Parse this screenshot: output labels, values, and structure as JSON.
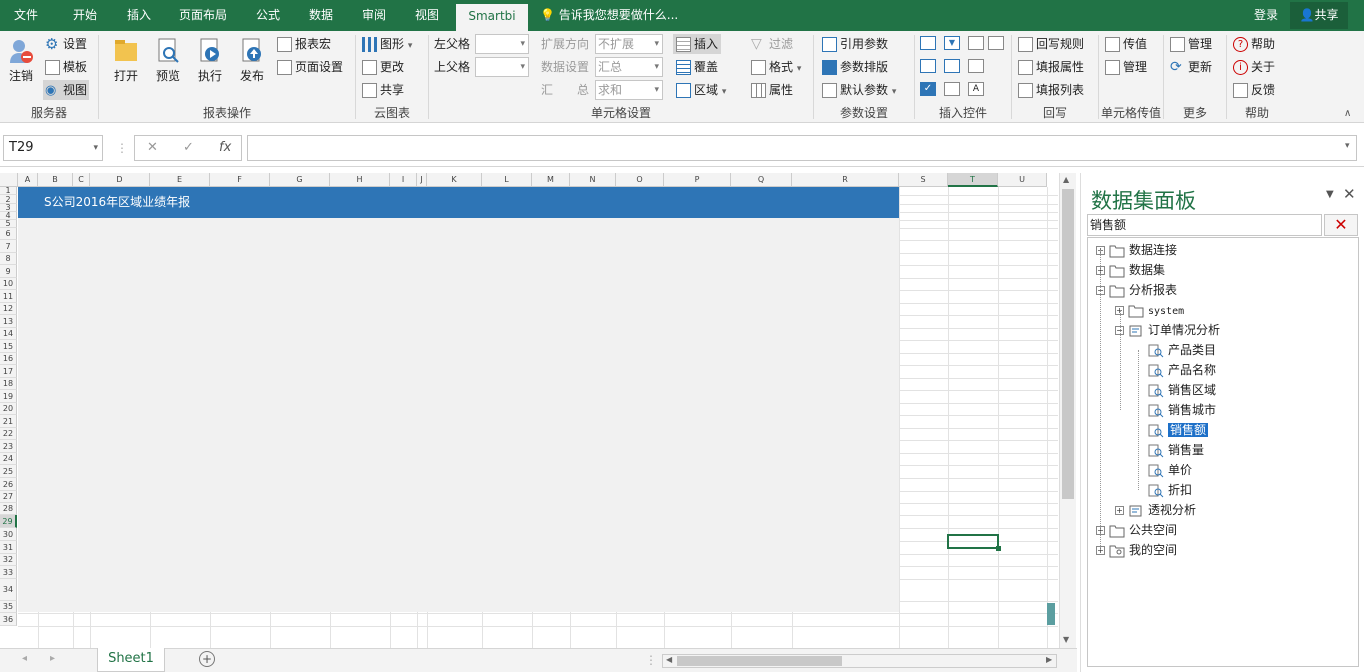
{
  "tabs": [
    "文件",
    "开始",
    "插入",
    "页面布局",
    "公式",
    "数据",
    "审阅",
    "视图",
    "Smartbi"
  ],
  "tell_me": "告诉我您想要做什么...",
  "login": "登录",
  "share": "共享",
  "ribbon": {
    "server": {
      "logout": "注销",
      "settings": "设置",
      "template": "模板",
      "view": "视图",
      "group": "服务器"
    },
    "report_ops": {
      "open": "打开",
      "preview": "预览",
      "execute": "执行",
      "publish": "发布",
      "report_macro": "报表宏",
      "page_setup": "页面设置",
      "group": "报表操作"
    },
    "cloud": {
      "chart": "图形",
      "change": "更改",
      "share": "共享",
      "group": "云图表"
    },
    "cell_settings": {
      "left_parent": "左父格",
      "upper_parent": "上父格",
      "expand_direction": "扩展方向",
      "expand_value": "不扩展",
      "data_setting": "数据设置",
      "data_value": "汇总",
      "summary": "汇　　总",
      "summary_value": "求和",
      "insert": "插入",
      "overwrite": "覆盖",
      "region": "区域",
      "filter": "过滤",
      "format": "格式",
      "property": "属性",
      "group": "单元格设置"
    },
    "params": {
      "cite": "引用参数",
      "layout": "参数排版",
      "default": "默认参数",
      "group": "参数设置"
    },
    "controls": {
      "group": "插入控件"
    },
    "writeback": {
      "rule": "回写规则",
      "attr": "填报属性",
      "list": "填报列表",
      "group": "回写"
    },
    "cell_value": {
      "transfer": "传值",
      "manage": "管理",
      "group": "单元格传值"
    },
    "more": {
      "manage": "管理",
      "update": "更新",
      "group": "更多"
    },
    "help": {
      "help": "帮助",
      "about": "关于",
      "feedback": "反馈",
      "group": "帮助"
    }
  },
  "formula_bar": {
    "name_box": "T29",
    "value": ""
  },
  "columns": [
    "A",
    "B",
    "C",
    "D",
    "E",
    "F",
    "G",
    "H",
    "I",
    "J",
    "K",
    "L",
    "M",
    "N",
    "O",
    "P",
    "Q",
    "R",
    "S",
    "T",
    "U"
  ],
  "rows": [
    "1",
    "2",
    "3",
    "4",
    "5",
    "6",
    "7",
    "8",
    "9",
    "10",
    "11",
    "12",
    "13",
    "14",
    "15",
    "16",
    "17",
    "18",
    "19",
    "20",
    "21",
    "22",
    "23",
    "24",
    "25",
    "26",
    "27",
    "28",
    "29",
    "30",
    "31",
    "32",
    "33",
    "34",
    "35",
    "36"
  ],
  "banner_title": "S公司2016年区域业绩年报",
  "sheet_tab": "Sheet1",
  "panel": {
    "title": "数据集面板",
    "search_value": "销售额",
    "tree": [
      {
        "label": "数据连接",
        "level": 0,
        "toggle": "+",
        "icon": "folder"
      },
      {
        "label": "数据集",
        "level": 0,
        "toggle": "+",
        "icon": "folder"
      },
      {
        "label": "分析报表",
        "level": 0,
        "toggle": "-",
        "icon": "folder"
      },
      {
        "label": "system",
        "level": 1,
        "toggle": "+",
        "icon": "folder"
      },
      {
        "label": "订单情况分析",
        "level": 1,
        "toggle": "-",
        "icon": "query"
      },
      {
        "label": "产品类目",
        "level": 2,
        "toggle": "",
        "icon": "field"
      },
      {
        "label": "产品名称",
        "level": 2,
        "toggle": "",
        "icon": "field"
      },
      {
        "label": "销售区域",
        "level": 2,
        "toggle": "",
        "icon": "field"
      },
      {
        "label": "销售城市",
        "level": 2,
        "toggle": "",
        "icon": "field"
      },
      {
        "label": "销售额",
        "level": 2,
        "toggle": "",
        "icon": "field",
        "selected": true
      },
      {
        "label": "销售量",
        "level": 2,
        "toggle": "",
        "icon": "field"
      },
      {
        "label": "单价",
        "level": 2,
        "toggle": "",
        "icon": "field"
      },
      {
        "label": "折扣",
        "level": 2,
        "toggle": "",
        "icon": "field"
      },
      {
        "label": "透视分析",
        "level": 1,
        "toggle": "+",
        "icon": "query"
      },
      {
        "label": "公共空间",
        "level": 0,
        "toggle": "+",
        "icon": "folder"
      },
      {
        "label": "我的空间",
        "level": 0,
        "toggle": "+",
        "icon": "userfolder"
      }
    ]
  }
}
